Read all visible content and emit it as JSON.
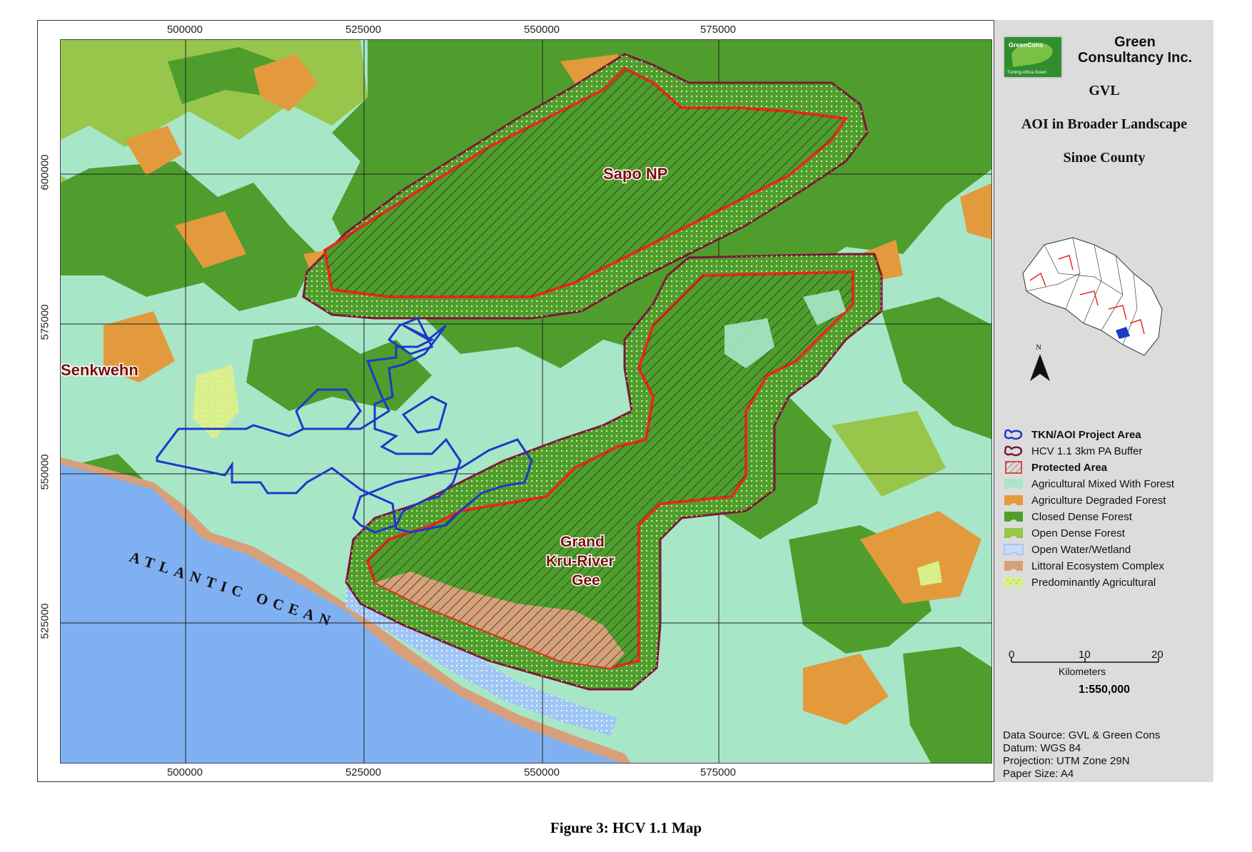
{
  "map": {
    "x_ticks": [
      "500000",
      "525000",
      "550000",
      "575000"
    ],
    "y_ticks": [
      "600000",
      "575000",
      "550000",
      "525000"
    ],
    "labels": {
      "sapo": "Sapo NP",
      "senkwehn": "Senkwehn",
      "grand1": "Grand",
      "grand2": "Kru-River",
      "grand3": "Gee",
      "ocean": "ATLANTIC OCEAN"
    },
    "colors": {
      "ag_mixed": "#a8e6c8",
      "ag_degraded": "#e39a3c",
      "closed_dense": "#4f9e2d",
      "open_dense": "#97c64a",
      "water": "#7fb0f2",
      "littoral": "#d8a07a",
      "pred_ag": "#d8ef8a",
      "project": "#1c39c9",
      "buffer": "#7a1836",
      "protected": "#e8281e"
    }
  },
  "panel": {
    "logo_brand": "GreenCons",
    "logo_tagline": "Turning Africa Green",
    "company_line1": "Green",
    "company_line2": "Consultancy Inc.",
    "title1": "GVL",
    "title2": "AOI in Broader Landscape",
    "title3": "Sinoe County",
    "north": "N"
  },
  "legend": [
    {
      "label": "TKN/AOI Project Area",
      "bold": true
    },
    {
      "label": "HCV 1.1 3km PA Buffer",
      "bold": false
    },
    {
      "label": "Protected Area",
      "bold": true
    },
    {
      "label": "Agricultural Mixed With Forest",
      "bold": false
    },
    {
      "label": "Agriculture Degraded Forest",
      "bold": false
    },
    {
      "label": "Closed Dense Forest",
      "bold": false
    },
    {
      "label": "Open Dense Forest",
      "bold": false
    },
    {
      "label": "Open Water/Wetland",
      "bold": false
    },
    {
      "label": "Littoral Ecosystem Complex",
      "bold": false
    },
    {
      "label": "Predominantly Agricultural",
      "bold": false
    }
  ],
  "scale": {
    "ticks": [
      "0",
      "10",
      "20"
    ],
    "unit": "Kilometers",
    "ratio": "1:550,000"
  },
  "meta": {
    "source": "Data Source: GVL & Green Cons",
    "datum": "Datum: WGS 84",
    "projection": "Projection: UTM Zone 29N",
    "paper": "Paper Size: A4"
  },
  "caption": "Figure 3: HCV 1.1 Map"
}
